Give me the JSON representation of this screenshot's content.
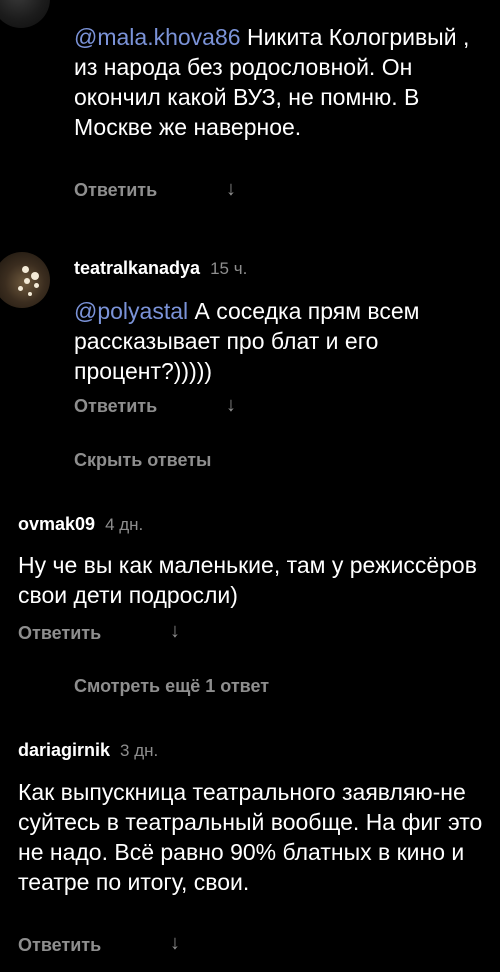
{
  "comments": [
    {
      "mention": "@mala.khova86",
      "text": " Никита Кологривый , из народа без родословной. Он окончил какой ВУЗ, не помню. В Москве же наверное.",
      "reply_label": "Ответить",
      "arrow_icon": "↓"
    },
    {
      "username": "teatralkanadya",
      "time": "15 ч.",
      "mention": "@polyastal",
      "text": " А соседка прям всем рассказывает про блат и его процент?)))))",
      "reply_label": "Ответить",
      "arrow_icon": "↓"
    },
    {
      "username": "ovmak09",
      "time": "4 дн.",
      "text": "Ну че вы как маленькие, там у режиссёров свои дети подросли)",
      "reply_label": "Ответить",
      "arrow_icon": "↓"
    },
    {
      "username": "dariagirnik",
      "time": "3 дн.",
      "text": "Как выпускница театрального заявляю-не суйтесь в театральный вообще. На фиг это не надо. Всё равно 90% блатных в кино и театре по итогу, свои.",
      "reply_label": "Ответить",
      "arrow_icon": "↓"
    }
  ],
  "hide_replies_label": "Скрыть ответы",
  "view_more_label": "Смотреть ещё 1 ответ",
  "colors": {
    "background": "#000000",
    "text": "#ffffff",
    "muted": "#8e8e8e",
    "mention": "#7b93d8"
  }
}
